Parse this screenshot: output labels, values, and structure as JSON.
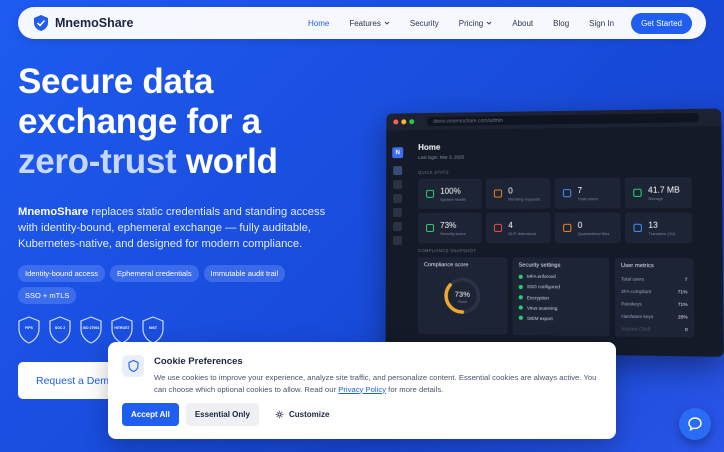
{
  "brand": {
    "name": "MnemoShare"
  },
  "nav": {
    "items": [
      {
        "label": "Home",
        "active": true
      },
      {
        "label": "Features",
        "dropdown": true
      },
      {
        "label": "Security"
      },
      {
        "label": "Pricing",
        "dropdown": true
      },
      {
        "label": "About"
      },
      {
        "label": "Blog"
      },
      {
        "label": "Sign In"
      }
    ],
    "cta": "Get Started"
  },
  "hero": {
    "title_line1": "Secure data",
    "title_line2": "exchange for a",
    "title_accent": "zero-trust",
    "title_end": " world",
    "desc_brand": "MnemoShare",
    "desc_rest": " replaces static credentials and standing access with identity-bound, ephemeral exchange — fully auditable, Kubernetes-native, and designed for modern compliance.",
    "tags": [
      "Identity-bound access",
      "Ephemeral credentials",
      "Immutable audit trail",
      "SSO + mTLS"
    ],
    "badges": [
      "FIPS",
      "SOC 2",
      "ISO 27001",
      "HITRUST",
      "NIST"
    ],
    "request_button": "Request a Demo"
  },
  "dashboard": {
    "url": "demo.mnemoshare.com/admin",
    "title": "Home",
    "subtitle": "Last login: Mar 3, 2025",
    "quick_stats_label": "QUICK STATS",
    "stats": [
      {
        "value": "100%",
        "label": "System health",
        "color": "#2ecc71"
      },
      {
        "value": "0",
        "label": "Pending requests",
        "color": "#e67e22"
      },
      {
        "value": "7",
        "label": "Total users",
        "color": "#3f8cf0"
      },
      {
        "value": "41.7 MB",
        "label": "Storage",
        "color": "#2ecc71"
      },
      {
        "value": "73%",
        "label": "Security score",
        "color": "#2ecc71"
      },
      {
        "value": "4",
        "label": "DLP detections",
        "color": "#e74c3c"
      },
      {
        "value": "0",
        "label": "Quarantined files",
        "color": "#e67e22"
      },
      {
        "value": "13",
        "label": "Transfers (7d)",
        "color": "#3f8cf0"
      }
    ],
    "compliance_label": "COMPLIANCE SNAPSHOT",
    "compliance": {
      "title": "Compliance score",
      "value": "73%",
      "label": "Good",
      "score": 0.73
    },
    "security": {
      "title": "Security settings",
      "items": [
        "MFA enforced",
        "SSO configured",
        "Encryption",
        "Virus scanning",
        "SIEM export"
      ]
    },
    "user_metrics": {
      "title": "User metrics",
      "rows": [
        {
          "label": "Total users",
          "value": "7"
        },
        {
          "label": "2FA compliant",
          "value": "71%"
        },
        {
          "label": "Passkeys",
          "value": "71%"
        },
        {
          "label": "Hardware keys",
          "value": "28%"
        },
        {
          "label": "Inactive (30d)",
          "value": "0"
        }
      ]
    }
  },
  "cookie": {
    "title": "Cookie Preferences",
    "text": "We use cookies to improve your experience, analyze site traffic, and personalize content. Essential cookies are always active. You can choose which optional cookies to allow. Read our ",
    "link": "Privacy Policy",
    "text_end": " for more details.",
    "accept": "Accept All",
    "essential": "Essential Only",
    "customize": "Customize"
  }
}
